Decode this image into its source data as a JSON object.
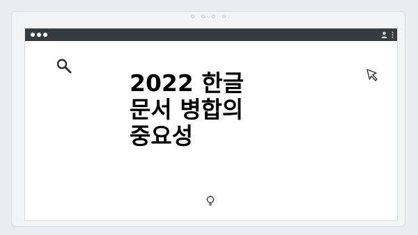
{
  "headline": {
    "line1": "2022 한글",
    "line2": "문서 병합의",
    "line3": "중요성"
  },
  "icons": {
    "search": "search-icon",
    "cursor": "cursor-arrow-icon",
    "lightbulb": "lightbulb-icon",
    "user": "user-icon",
    "menu": "kebab-menu-icon"
  },
  "colors": {
    "titlebar": "#363b40",
    "background": "#e9edf1",
    "text": "#000000"
  }
}
